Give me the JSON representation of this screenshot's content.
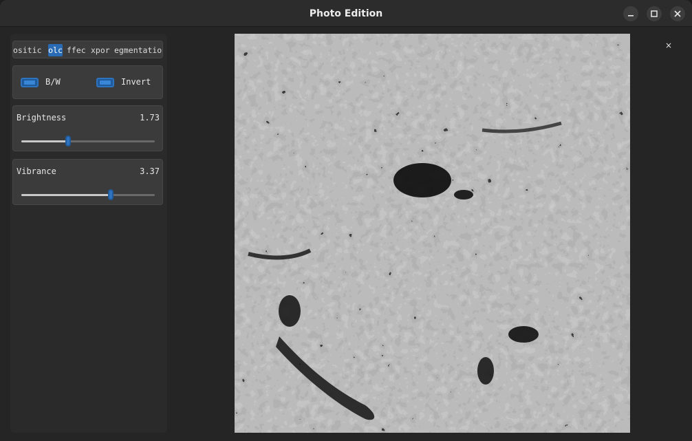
{
  "window": {
    "title": "Photo Edition"
  },
  "controls": {
    "minimize_icon": "minimize-icon",
    "maximize_icon": "maximize-icon",
    "close_icon": "close-icon"
  },
  "tabs": [
    {
      "label": "ositic",
      "active": false
    },
    {
      "label": "olc",
      "active": true
    },
    {
      "label": "ffec",
      "active": false
    },
    {
      "label": "xpor",
      "active": false
    },
    {
      "label": "egmentatio",
      "active": false
    }
  ],
  "toggles": [
    {
      "label": "B/W",
      "on": true
    },
    {
      "label": "Invert",
      "on": true
    }
  ],
  "sliders": [
    {
      "label": "Brightness",
      "value": "1.73",
      "fraction": 0.35
    },
    {
      "label": "Vibrance",
      "value": "3.37",
      "fraction": 0.67
    }
  ],
  "canvas_close": "×",
  "colors": {
    "accent": "#2f72bd",
    "panel": "#3b3b3b",
    "background": "#252525",
    "image_gray": "#7e7e7e"
  }
}
